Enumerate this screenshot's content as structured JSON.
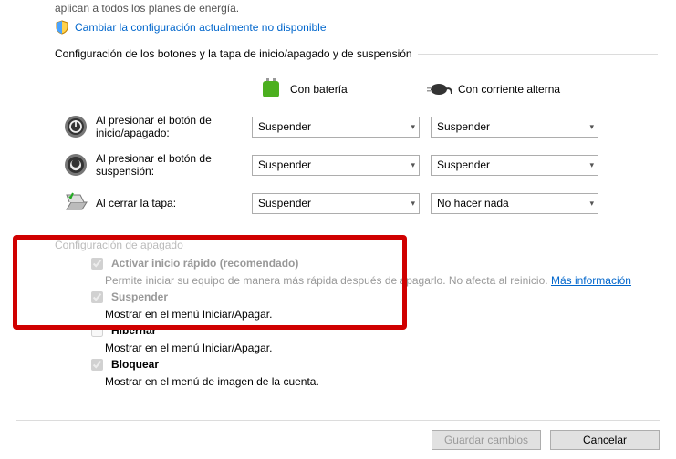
{
  "top_text_cut": "aplican a todos los planes de energía.",
  "admin_link": "Cambiar la configuración actualmente no disponible",
  "section_buttons": "Configuración de los botones y la tapa de inicio/apagado y de suspensión",
  "headers": {
    "battery": "Con batería",
    "plugged": "Con corriente alterna"
  },
  "rows": {
    "power_btn": {
      "label": "Al presionar el botón de inicio/apagado:",
      "bat": "Suspender",
      "plug": "Suspender"
    },
    "sleep_btn": {
      "label": "Al presionar el botón de suspensión:",
      "bat": "Suspender",
      "plug": "Suspender"
    },
    "lid": {
      "label": "Al cerrar la tapa:",
      "bat": "Suspender",
      "plug": "No hacer nada"
    }
  },
  "shutdown_title": "Configuración de apagado",
  "opts": {
    "fast": {
      "label": "Activar inicio rápido (recomendado)",
      "desc1": "Permite iniciar su equipo de manera más rápida después de apagarlo. No afecta al reinicio. ",
      "more": "Más información"
    },
    "sleep": {
      "label": "Suspender",
      "desc": "Mostrar en el menú Iniciar/Apagar."
    },
    "hibernate": {
      "label": "Hibernar",
      "desc": "Mostrar en el menú Iniciar/Apagar."
    },
    "lock": {
      "label": "Bloquear",
      "desc": "Mostrar en el menú de imagen de la cuenta."
    }
  },
  "buttons": {
    "save": "Guardar cambios",
    "cancel": "Cancelar"
  }
}
